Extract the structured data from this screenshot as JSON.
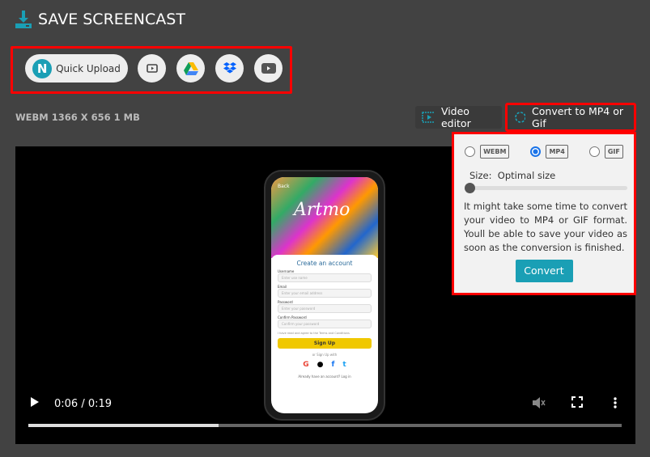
{
  "header": {
    "title": "SAVE SCREENCAST"
  },
  "upload": {
    "quick_upload": "Quick Upload",
    "quick_upload_logo": "N",
    "buttons": [
      "screencastify-icon",
      "google-drive-icon",
      "dropbox-icon",
      "youtube-icon"
    ]
  },
  "file_info": "WEBM 1366 X 656 1 MB",
  "toolbar": {
    "video_editor": "Video editor",
    "convert": "Convert to MP4 or Gif"
  },
  "popup": {
    "formats": [
      "WEBM",
      "MP4",
      "GIF"
    ],
    "selected": "MP4",
    "size_label": "Size:",
    "size_value": "Optimal size",
    "size_level": 0,
    "message": "It might take some time to convert your video to MP4 or GIF format. Youll be able to save your video as soon as the conversion is finished.",
    "convert_button": "Convert"
  },
  "player": {
    "time": "0:06 / 0:19",
    "progress": 0.32
  },
  "phone": {
    "back": "Back",
    "brand": "Artmo",
    "heading": "Create an account",
    "fields": [
      {
        "label": "Username",
        "placeholder": "Enter use name"
      },
      {
        "label": "Email",
        "placeholder": "Enter your email address"
      },
      {
        "label": "Password",
        "placeholder": "Enter your password"
      },
      {
        "label": "Confirm Password",
        "placeholder": "Confirm your password"
      }
    ],
    "terms": "I have read and agree to the Terms and Conditions",
    "signup": "Sign Up",
    "or": "or Sign Up with",
    "login": "Already have an account? Log in"
  },
  "colors": {
    "accent": "#1a9fb5",
    "highlight": "#ff0000"
  }
}
